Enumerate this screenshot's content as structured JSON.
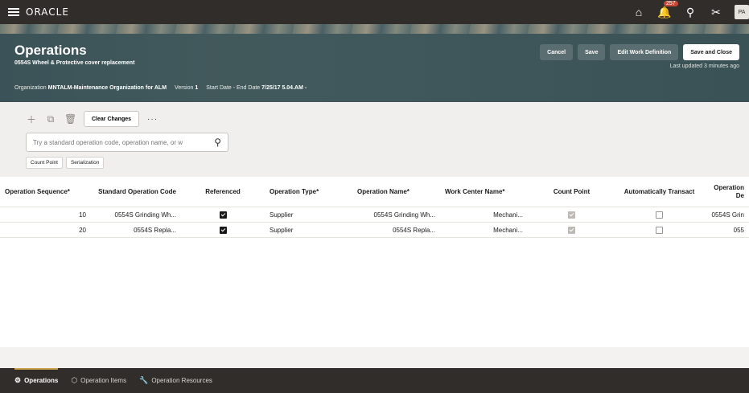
{
  "topbar": {
    "logo": "ORACLE",
    "notification_count": "257",
    "avatar_initials": "PA"
  },
  "header": {
    "title": "Operations",
    "subtitle": "0554S Wheel & Protective cover replacement",
    "org_label": "Organization",
    "org_value": "MNTALM-Maintenance Organization for ALM",
    "version_label": "Version",
    "version_value": "1",
    "dates_label": "Start Date - End Date",
    "dates_value": "7/25/17 5.04.AM -",
    "cancel_label": "Cancel",
    "save_label": "Save",
    "edit_wd_label": "Edit Work Definition",
    "save_close_label": "Save and Close",
    "last_updated": "Last updated 3 minutes ago"
  },
  "toolbar": {
    "clear_changes_label": "Clear Changes",
    "more_label": "···",
    "search_placeholder": "Try a standard operation code, operation name, or w",
    "chips": [
      "Count Point",
      "Serialization"
    ]
  },
  "table": {
    "headers": [
      "Operation Sequence*",
      "Standard Operation Code",
      "Referenced",
      "Operation Type*",
      "Operation Name*",
      "Work Center Name*",
      "Count Point",
      "Automatically Transact",
      "Operation De"
    ],
    "rows": [
      {
        "seq": "10",
        "code": "0554S Grinding Wh...",
        "referenced": true,
        "type": "Supplier",
        "name": "0554S Grinding Wh...",
        "work_center": "Mechani...",
        "count_point": true,
        "auto_transact": false,
        "desc": "0554S Grin"
      },
      {
        "seq": "20",
        "code": "0554S Repla...",
        "referenced": true,
        "type": "Supplier",
        "name": "0554S Repla...",
        "work_center": "Mechani...",
        "count_point": true,
        "auto_transact": false,
        "desc": "055"
      }
    ]
  },
  "bottom_tabs": {
    "operations": "Operations",
    "operation_items": "Operation Items",
    "operation_resources": "Operation Resources"
  }
}
